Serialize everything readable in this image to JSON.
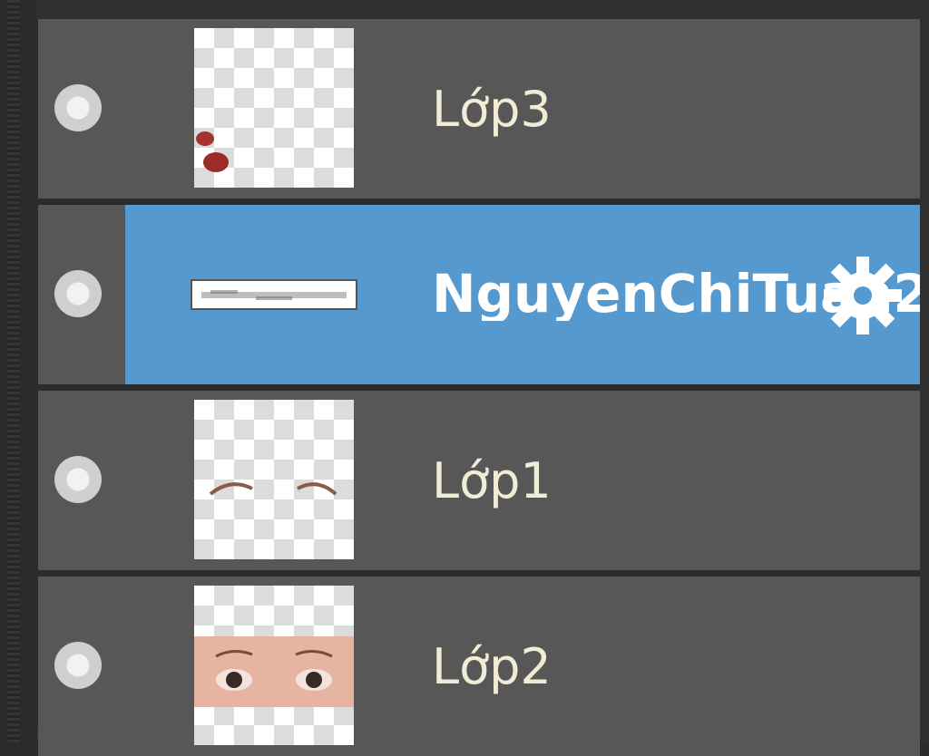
{
  "layers_panel": {
    "layers": [
      {
        "name": "Lớp3",
        "selected": false,
        "thumbnail": "transparent-checker-with-red-dots",
        "visibility_icon": "eye-dot-icon"
      },
      {
        "name": "NguyenChiTuan2",
        "selected": true,
        "thumbnail": "text-layer-thumbnail",
        "visibility_icon": "eye-dot-icon",
        "badge_icon": "gear-icon"
      },
      {
        "name": "Lớp1",
        "selected": false,
        "thumbnail": "transparent-checker-with-eyebrows",
        "visibility_icon": "eye-dot-icon"
      },
      {
        "name": "Lớp2",
        "selected": false,
        "thumbnail": "eyes-photo",
        "visibility_icon": "eye-dot-icon"
      }
    ],
    "colors": {
      "row_bg": "#575757",
      "selected_bg": "#5599cf",
      "text": "#f0ecd6",
      "selected_text": "#ffffff"
    }
  }
}
